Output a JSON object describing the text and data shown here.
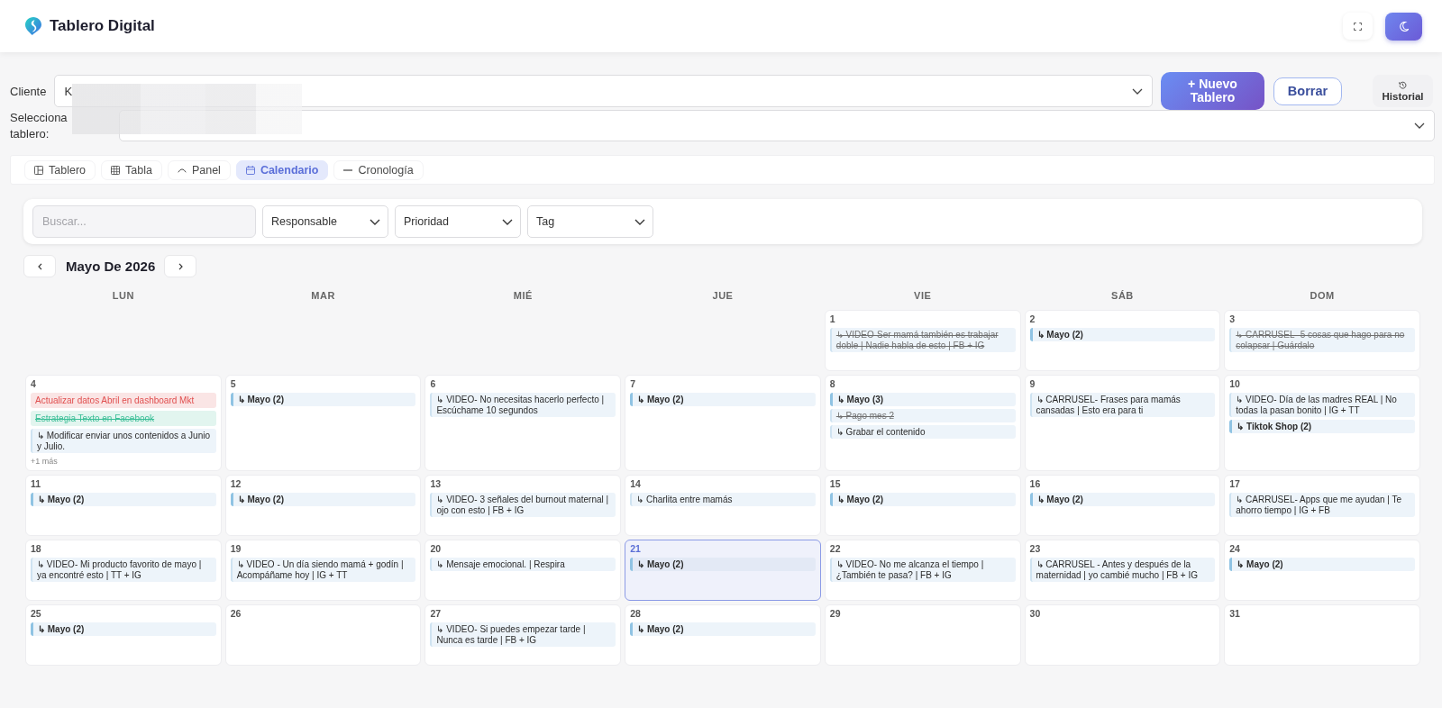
{
  "header": {
    "title": "Tablero Digital"
  },
  "client": {
    "label": "Cliente",
    "value": "K"
  },
  "actions": [
    {
      "kind": "primary",
      "label": "+ Nuevo Tablero"
    },
    {
      "kind": "outline",
      "label": "Borrar"
    },
    {
      "kind": "history",
      "label": "Historial"
    }
  ],
  "board": {
    "label": "Selecciona tablero:"
  },
  "view_tabs": [
    {
      "kind": "board",
      "label": "Tablero",
      "selected": false
    },
    {
      "kind": "table",
      "label": "Tabla",
      "selected": false
    },
    {
      "kind": "panel",
      "label": "Panel",
      "selected": false
    },
    {
      "kind": "calendar",
      "label": "Calendario",
      "selected": true
    },
    {
      "kind": "timeline",
      "label": "Cronología",
      "selected": false
    }
  ],
  "filters": {
    "search": {
      "placeholder": "Buscar..."
    },
    "selects": [
      {
        "value": "Responsable"
      },
      {
        "value": "Prioridad"
      },
      {
        "value": "Tag"
      }
    ]
  },
  "calendar": {
    "month": "Mayo De 2026",
    "weekdays": [
      "LUN",
      "MAR",
      "MIÉ",
      "JUE",
      "VIE",
      "SÁB",
      "DOM"
    ],
    "weeks": [
      {
        "days": [
          {
            "kind": "blank"
          },
          {
            "kind": "blank"
          },
          {
            "kind": "blank"
          },
          {
            "kind": "blank"
          },
          {
            "kind": "day",
            "date": "1",
            "today": false,
            "items": [
              {
                "kind": "subtask",
                "text": "↳ VIDEO-Ser mamá también es trabajar doble | Nadie habla de esto | FB + IG",
                "done": true
              }
            ]
          },
          {
            "kind": "day",
            "date": "2",
            "today": false,
            "items": [
              {
                "kind": "group",
                "text": "↳ Mayo (2)",
                "done": false
              }
            ]
          },
          {
            "kind": "day",
            "date": "3",
            "today": false,
            "items": [
              {
                "kind": "subtask",
                "text": "↳ CARRUSEL- 5 cosas que hago para no colapsar | Guárdalo",
                "done": true
              }
            ]
          }
        ]
      },
      {
        "days": [
          {
            "kind": "day",
            "date": "4",
            "today": false,
            "items": [
              {
                "kind": "task",
                "text": "Actualizar datos Abril en dashboard Mkt",
                "color": "#e04f4f",
                "done": false
              },
              {
                "kind": "task",
                "text": "Estrategia Texto en Facebook",
                "color": "#3bbf97",
                "done": true
              },
              {
                "kind": "subtask",
                "text": "↳ Modificar enviar unos contenidos a Junio y Julio.",
                "done": false
              }
            ],
            "more": "+1 más"
          },
          {
            "kind": "day",
            "date": "5",
            "today": false,
            "items": [
              {
                "kind": "group",
                "text": "↳ Mayo (2)",
                "done": false
              }
            ]
          },
          {
            "kind": "day",
            "date": "6",
            "today": false,
            "items": [
              {
                "kind": "subtask",
                "text": "↳ VIDEO- No necesitas hacerlo perfecto | Escúchame 10 segundos",
                "done": false
              }
            ]
          },
          {
            "kind": "day",
            "date": "7",
            "today": false,
            "items": [
              {
                "kind": "group",
                "text": "↳ Mayo (2)",
                "done": false
              }
            ]
          },
          {
            "kind": "day",
            "date": "8",
            "today": false,
            "items": [
              {
                "kind": "group",
                "text": "↳ Mayo (3)",
                "done": false
              },
              {
                "kind": "subtask",
                "text": "↳ Pago mes 2",
                "done": true
              },
              {
                "kind": "subtask",
                "text": "↳ Grabar el contenido",
                "done": false
              }
            ]
          },
          {
            "kind": "day",
            "date": "9",
            "today": false,
            "items": [
              {
                "kind": "subtask",
                "text": "↳ CARRUSEL- Frases para mamás cansadas | Esto era para ti",
                "done": false
              }
            ]
          },
          {
            "kind": "day",
            "date": "10",
            "today": false,
            "items": [
              {
                "kind": "subtask",
                "text": "↳ VIDEO- Día de las madres REAL | No todas la pasan bonito | IG + TT",
                "done": false
              },
              {
                "kind": "group",
                "text": "↳ Tiktok Shop (2)",
                "done": false
              }
            ]
          }
        ]
      },
      {
        "days": [
          {
            "kind": "day",
            "date": "11",
            "today": false,
            "items": [
              {
                "kind": "group",
                "text": "↳ Mayo (2)",
                "done": false
              }
            ]
          },
          {
            "kind": "day",
            "date": "12",
            "today": false,
            "items": [
              {
                "kind": "group",
                "text": "↳ Mayo (2)",
                "done": false
              }
            ]
          },
          {
            "kind": "day",
            "date": "13",
            "today": false,
            "items": [
              {
                "kind": "subtask",
                "text": "↳ VIDEO- 3 señales del burnout maternal | ojo con esto | FB + IG",
                "done": false
              }
            ]
          },
          {
            "kind": "day",
            "date": "14",
            "today": false,
            "items": [
              {
                "kind": "subtask",
                "text": "↳ Charlita entre mamás",
                "done": false
              }
            ]
          },
          {
            "kind": "day",
            "date": "15",
            "today": false,
            "items": [
              {
                "kind": "group",
                "text": "↳ Mayo (2)",
                "done": false
              }
            ]
          },
          {
            "kind": "day",
            "date": "16",
            "today": false,
            "items": [
              {
                "kind": "group",
                "text": "↳ Mayo (2)",
                "done": false
              }
            ]
          },
          {
            "kind": "day",
            "date": "17",
            "today": false,
            "items": [
              {
                "kind": "subtask",
                "text": "↳ CARRUSEL- Apps que me ayudan | Te ahorro tiempo | IG + FB",
                "done": false
              }
            ]
          }
        ]
      },
      {
        "days": [
          {
            "kind": "day",
            "date": "18",
            "today": false,
            "items": [
              {
                "kind": "subtask",
                "text": "↳ VIDEO- Mi producto favorito de mayo | ya encontré esto | TT + IG",
                "done": false
              }
            ]
          },
          {
            "kind": "day",
            "date": "19",
            "today": false,
            "items": [
              {
                "kind": "subtask",
                "text": "↳ VIDEO - Un día siendo mamá + godín | Acompáñame hoy | IG + TT",
                "done": false
              }
            ]
          },
          {
            "kind": "day",
            "date": "20",
            "today": false,
            "items": [
              {
                "kind": "subtask",
                "text": "↳ Mensaje emocional. | Respira",
                "done": false
              }
            ]
          },
          {
            "kind": "day",
            "date": "21",
            "today": true,
            "items": [
              {
                "kind": "group",
                "text": "↳ Mayo (2)",
                "done": false
              }
            ]
          },
          {
            "kind": "day",
            "date": "22",
            "today": false,
            "items": [
              {
                "kind": "subtask",
                "text": "↳ VIDEO- No me alcanza el tiempo | ¿También te pasa? | FB + IG",
                "done": false
              }
            ]
          },
          {
            "kind": "day",
            "date": "23",
            "today": false,
            "items": [
              {
                "kind": "subtask",
                "text": "↳ CARRUSEL - Antes y después de la maternidad | yo cambié mucho | FB + IG",
                "done": false
              }
            ]
          },
          {
            "kind": "day",
            "date": "24",
            "today": false,
            "items": [
              {
                "kind": "group",
                "text": "↳ Mayo (2)",
                "done": false
              }
            ]
          }
        ]
      },
      {
        "days": [
          {
            "kind": "day",
            "date": "25",
            "today": false,
            "items": [
              {
                "kind": "group",
                "text": "↳ Mayo (2)",
                "done": false
              }
            ]
          },
          {
            "kind": "day",
            "date": "26",
            "today": false
          },
          {
            "kind": "day",
            "date": "27",
            "today": false,
            "items": [
              {
                "kind": "subtask",
                "text": "↳ VIDEO- Si puedes empezar tarde | Nunca es tarde | FB + IG",
                "done": false
              }
            ]
          },
          {
            "kind": "day",
            "date": "28",
            "today": false,
            "items": [
              {
                "kind": "group",
                "text": "↳ Mayo (2)",
                "done": false
              }
            ]
          },
          {
            "kind": "day",
            "date": "29",
            "today": false
          },
          {
            "kind": "day",
            "date": "30",
            "today": false
          },
          {
            "kind": "day",
            "date": "31",
            "today": false
          }
        ]
      }
    ]
  }
}
